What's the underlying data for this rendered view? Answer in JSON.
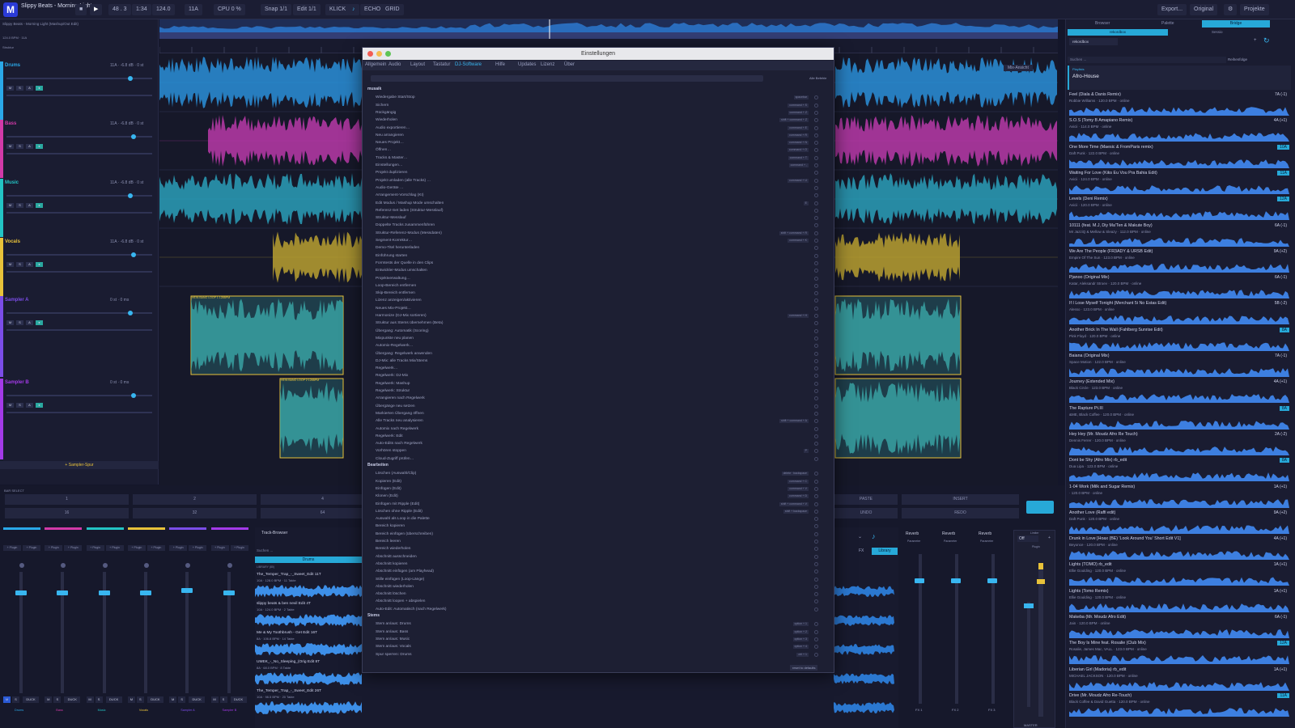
{
  "toolbar": {
    "logo": "M",
    "title": "Slippy Beats - Morning Light",
    "subtitle": "Slippy Beats - Morning Light (Mashup/Out Edit)",
    "bars": "48 . 3",
    "time": "1:34",
    "bpm": "124.0",
    "key": "11A",
    "cpu": "CPU 0 %",
    "snap": "Snap 1/1",
    "edit": "Edit 1/1",
    "klick": "KLICK",
    "echo": "ECHO",
    "grid": "GRID",
    "export": "Export...",
    "original": "Original",
    "projects": "Projekte"
  },
  "left": {
    "info1": "124.0 BPM · 11A",
    "info2": "Struktur",
    "tracks": [
      {
        "name": "Drums",
        "color": "#2aa8e8",
        "info": "11A · -6.8 dB · 0 st"
      },
      {
        "name": "Bass",
        "color": "#d23aa8",
        "info": "11A · -6.8 dB · 0 st"
      },
      {
        "name": "Music",
        "color": "#23c4c4",
        "info": "11A · -6.8 dB · 0 st"
      },
      {
        "name": "Vocals",
        "color": "#e8c23a",
        "info": "11A · -6.8 dB · 0 st"
      },
      {
        "name": "Sampler A",
        "color": "#7b4de8",
        "info": "0 st · 0 ms"
      },
      {
        "name": "Sampler B",
        "color": "#a33ae8",
        "info": "0 st · 0 ms"
      }
    ],
    "add_sampler": "+ Sampler-Spur"
  },
  "arrange": {
    "mix_view": "Mix-Ansicht",
    "clip_a": "HEIN BANG LOOP 1 128BPM",
    "clip_b": "HEIN BANG LOOP 2 128BPM"
  },
  "dialog": {
    "title": "Einstellungen",
    "tabs": [
      "Allgemein",
      "Audio",
      "Layout",
      "Tastatur",
      "DJ-Software",
      "Hilfe",
      "Updates",
      "Lizenz",
      "Über"
    ],
    "all_label": "Alle Befehle",
    "reset": "reset to defaults",
    "sections": [
      {
        "name": "musaik",
        "rows": [
          {
            "label": "Wiedergabe Start/Stop",
            "shortcut": "spacebar"
          },
          {
            "label": "Sichern",
            "shortcut": "command + S"
          },
          {
            "label": "Rückgängig",
            "shortcut": "command + Z"
          },
          {
            "label": "Wiederholen",
            "shortcut": "shift + command + Z"
          },
          {
            "label": "Audio exportieren…",
            "shortcut": "command + E"
          },
          {
            "label": "Neu arrangieren",
            "shortcut": "command + R"
          },
          {
            "label": "Neues Projekt…",
            "shortcut": "command + N"
          },
          {
            "label": "Öffnen…",
            "shortcut": "command + O"
          },
          {
            "label": "Tracks & Master…",
            "shortcut": "command + T"
          },
          {
            "label": "Einstellungen…",
            "shortcut": "command + ,"
          },
          {
            "label": "Projekt duplizieren",
            "shortcut": ""
          },
          {
            "label": "Projekt umladen (alle Tracks) …",
            "shortcut": "command + U"
          },
          {
            "label": "Audio-Geräte …",
            "shortcut": ""
          },
          {
            "label": "Arrangement-Vorschlag (KI)",
            "shortcut": ""
          },
          {
            "label": "Edit Modus / Mashup Mode umschalten",
            "shortcut": "E"
          },
          {
            "label": "Referenz-Set laden (Struktur-Messlauf)",
            "shortcut": ""
          },
          {
            "label": "Struktur-Messlauf",
            "shortcut": ""
          },
          {
            "label": "Doppelte Tracks zusammenführen",
            "shortcut": ""
          },
          {
            "label": "Struktur-Referenz-Modus (Messdaten)",
            "shortcut": "shift + command + R"
          },
          {
            "label": "Segment-Korrektur…",
            "shortcut": "command + K"
          },
          {
            "label": "Demo-Titel herunterladen",
            "shortcut": ""
          },
          {
            "label": "Einführung starten",
            "shortcut": ""
          },
          {
            "label": "Formtests der Quelle in den Clips",
            "shortcut": ""
          },
          {
            "label": "Entwickler-Modus umschalten",
            "shortcut": ""
          },
          {
            "label": "Projektverwaltung…",
            "shortcut": ""
          },
          {
            "label": "Loop-Bereich entfernen",
            "shortcut": ""
          },
          {
            "label": "Skip-Bereich entfernen",
            "shortcut": ""
          },
          {
            "label": "Lizenz anzeigen/aktivieren",
            "shortcut": ""
          },
          {
            "label": "Neues Mix-Projekt…",
            "shortcut": ""
          },
          {
            "label": "Harmonize (DJ-Mix sortieren)",
            "shortcut": "command + H"
          },
          {
            "label": "Struktur aus Stems übernehmen (Beta)",
            "shortcut": ""
          },
          {
            "label": "Übergang: Automatik (Scoring)",
            "shortcut": ""
          },
          {
            "label": "Mixpunkte neu planen",
            "shortcut": ""
          },
          {
            "label": "Automix-Regelwerk…",
            "shortcut": ""
          },
          {
            "label": "Übergang: Regelwerk anwenden",
            "shortcut": ""
          },
          {
            "label": "DJ-Mix: alle Tracks Mix/Stems",
            "shortcut": ""
          },
          {
            "label": "Regelwerk…",
            "shortcut": ""
          },
          {
            "label": "Regelwerk: DJ-Mix",
            "shortcut": ""
          },
          {
            "label": "Regelwerk: Mashup",
            "shortcut": ""
          },
          {
            "label": "Regelwerk: Struktur",
            "shortcut": ""
          },
          {
            "label": "Arrangieren nach Regelwerk",
            "shortcut": ""
          },
          {
            "label": "Übergänge neu setzen",
            "shortcut": ""
          },
          {
            "label": "Markierten Übergang öffnen",
            "shortcut": ""
          },
          {
            "label": "Alle Tracks neu analysieren",
            "shortcut": "shift + command + A"
          },
          {
            "label": "Automix nach Regelwerk",
            "shortcut": ""
          },
          {
            "label": "Regelwerk: Edit",
            "shortcut": ""
          },
          {
            "label": "Auto-Edits nach Regelwerk",
            "shortcut": ""
          },
          {
            "label": "Vorhören stoppen",
            "shortcut": "P"
          },
          {
            "label": "Cloud-Zugriff prüfen…",
            "shortcut": ""
          }
        ]
      },
      {
        "name": "Bearbeiten",
        "rows": [
          {
            "label": "Löschen (Auswahl/Clip)",
            "shortcut": "delete · backspace"
          },
          {
            "label": "Kopieren (Edit)",
            "shortcut": "command + C"
          },
          {
            "label": "Einfügen (Edit)",
            "shortcut": "command + V"
          },
          {
            "label": "Klonen (Edit)",
            "shortcut": "command + D"
          },
          {
            "label": "Einfügen mit Ripple (Edit)",
            "shortcut": "shift + command + V"
          },
          {
            "label": "Löschen ohne Ripple (Edit)",
            "shortcut": "shift + backspace"
          },
          {
            "label": "Auswahl als Loop in die Palette",
            "shortcut": ""
          },
          {
            "label": "Bereich kopieren",
            "shortcut": ""
          },
          {
            "label": "Bereich einfügen (überschreiben)",
            "shortcut": ""
          },
          {
            "label": "Bereich leeren",
            "shortcut": ""
          },
          {
            "label": "Bereich wiederholen",
            "shortcut": ""
          },
          {
            "label": "Abschnitt ausschneiden",
            "shortcut": ""
          },
          {
            "label": "Abschnitt kopieren",
            "shortcut": ""
          },
          {
            "label": "Abschnitt einfügen (am Playhead)",
            "shortcut": ""
          },
          {
            "label": "Stille einfügen (Loop-Länge)",
            "shortcut": ""
          },
          {
            "label": "Abschnitt wiederholen",
            "shortcut": ""
          },
          {
            "label": "Abschnitt löschen",
            "shortcut": ""
          },
          {
            "label": "Abschnitt loopen + abspielen",
            "shortcut": ""
          },
          {
            "label": "Auto-Edit: Automatisch (nach Regelwerk)",
            "shortcut": ""
          }
        ]
      },
      {
        "name": "Stems",
        "rows": [
          {
            "label": "Stem an/aus: Drums",
            "shortcut": "option + 1"
          },
          {
            "label": "Stem an/aus: Bass",
            "shortcut": "option + 2"
          },
          {
            "label": "Stem an/aus: Music",
            "shortcut": "option + 3"
          },
          {
            "label": "Stem an/aus: Vocals",
            "shortcut": "option + 4"
          },
          {
            "label": "Spur sperren: Drums",
            "shortcut": "ctrl + 1"
          }
        ]
      }
    ]
  },
  "right": {
    "tabs": [
      "Browser",
      "Palette",
      "Bridge"
    ],
    "subtabs": [
      "rekordbox",
      "Sessio"
    ],
    "source": "rekordbox",
    "search_placeholder": "Suchen ...",
    "sort": "Reihenfolge",
    "playlist_label": "Playlists",
    "playlist": "Afro-House",
    "songs": [
      {
        "title": "Feel (Diala & Danis Remix)",
        "sub": "Robbie Williams · 120.0 BPM · online",
        "key": "7A (-1)",
        "hl": false
      },
      {
        "title": "S.O.S (Tomy B Amapiano Remix)",
        "sub": "Avicii · 114.0 BPM · online",
        "key": "4A (+1)",
        "hl": false
      },
      {
        "title": "One More Time (Maesic & FromParis remix)",
        "sub": "Daft Punk · 122.0 BPM · online",
        "key": "10A",
        "hl": true
      },
      {
        "title": "Waiting For Love (Kiks Eu Vou Pra Bahia Edit)",
        "sub": "Avicii · 124.0 BPM · online",
        "key": "11A",
        "hl": true
      },
      {
        "title": "Levels (Deni Remix)",
        "sub": "Avicii · 120.0 BPM · online",
        "key": "12A",
        "hl": true
      },
      {
        "title": "10111 (feat. M.J, Diy Ma'Ten & Makute Boy)",
        "sub": "Mr JazziQ & Mellow & Sleazy · 112.0 BPM · online",
        "key": "6A (-1)",
        "hl": false
      },
      {
        "title": "We Are The People (FR3ADY & URSB Edit)",
        "sub": "Empire Of The Sun · 123.0 BPM · online",
        "key": "9A (+2)",
        "hl": false
      },
      {
        "title": "Pjanoo (Original Mix)",
        "sub": "Katar, Aleksandr Stroev · 120.0 BPM · online",
        "key": "6A (-1)",
        "hl": false
      },
      {
        "title": "If I Lose Myself Tonight (Merchant 5i No Estas Edit)",
        "sub": "Alesso · 123.0 BPM · online",
        "key": "5B (-2)",
        "hl": false
      },
      {
        "title": "Another Brick In The Wall (Fahlberg Sunrise Edit)",
        "sub": "Pink Floyd · 120.0 BPM · online",
        "key": "8A",
        "hl": true
      },
      {
        "title": "Baiana (Original Mix)",
        "sub": "Space Motion · 122.0 BPM · online",
        "key": "7A (-1)",
        "hl": false
      },
      {
        "title": "Journey (Extended Mix)",
        "sub": "Black Circle · 123.0 BPM · online",
        "key": "4A (+1)",
        "hl": false
      },
      {
        "title": "The Rapture Pt.III",
        "sub": "&ME, Black Coffee · 120.0 BPM · online",
        "key": "8A",
        "hl": true
      },
      {
        "title": "Hey Hey (Mr. Moudz Afro Re Touch)",
        "sub": "Dennis Ferrer · 120.0 BPM · online",
        "key": "2A (-2)",
        "hl": false
      },
      {
        "title": "Dont be Shy (Afro Mix) rb_edit",
        "sub": "Dua Lipa · 123.0 BPM · online",
        "key": "8A",
        "hl": true
      },
      {
        "title": "1-04 Work (Milk and Sugar Remix)",
        "sub": "· 120.0 BPM · online",
        "key": "1A (+1)",
        "hl": false
      },
      {
        "title": "Another Love (Raffi edit)",
        "sub": "Daft Punk · 120.0 BPM · online",
        "key": "9A (+2)",
        "hl": false
      },
      {
        "title": "Drunk in Love [Hoax (BE) 'Look Around You' Short Edit V1]",
        "sub": "Beyonce · 120.0 BPM · online",
        "key": "4A (+1)",
        "hl": false
      },
      {
        "title": "Lights (TOMO) rb_edit",
        "sub": "Ellie Goulding · 120.0 BPM · online",
        "key": "1A (+1)",
        "hl": false
      },
      {
        "title": "Lights (Tomo Remix)",
        "sub": "Ellie Goulding · 120.0 BPM · online",
        "key": "1A (+1)",
        "hl": false
      },
      {
        "title": "Makeba (Mr. Moudz Afro Edit)",
        "sub": "Jain · 120.0 BPM · online",
        "key": "6A (-1)",
        "hl": false
      },
      {
        "title": "The Boy Is Mine feat. Rosalie (Club Mix)",
        "sub": "Rosalie, James Mac, VALL · 123.0 BPM · online",
        "key": "12A",
        "hl": true
      },
      {
        "title": "Liberian Girl (Madoria) rb_edit",
        "sub": "MICHAEL JACKSON · 120.0 BPM · online",
        "key": "1A (+1)",
        "hl": false
      },
      {
        "title": "Drive (Mr. Moudz Afro Re-Touch)",
        "sub": "Black Coffee & David Guetta · 120.0 BPM · online",
        "key": "11A",
        "hl": true
      }
    ]
  },
  "bottom": {
    "bar_select": "BAR SELECT",
    "pads_top": [
      "1",
      "2",
      "4"
    ],
    "pads_bottom": [
      "16",
      "32",
      "64"
    ],
    "undo": "UNDO",
    "redo": "REDO",
    "paste": "PASTE",
    "insert": "INSERT",
    "track_browser": "Track-Browser",
    "search_placeholder": "Suchen ...",
    "drums_tab": "Drums",
    "library_header": "LIBRARY (80)",
    "fx_label": "FX",
    "library_btn": "Library",
    "clips": [
      {
        "title": "The_Temper_Trap_-_Sweet_Edit 11T",
        "sub": "10A · 128.0 BPM · 11 Takte"
      },
      {
        "title": "slippy beats & ben nevil Edit 4T",
        "sub": "10A · 124.0 BPM · 2 Takte"
      },
      {
        "title": "Me & My Toothbrush - Get Edit 16T",
        "sub": "8A · 106.8 BPM · 14 Takte"
      },
      {
        "title": "UMEK_-_No_Sleeping_(Orig Edit 8T",
        "sub": "8A · 68.0 BPM · 8 Takte"
      },
      {
        "title": "The_Temper_Trap_-_Sweet_Edit 26T",
        "sub": "10A · 98.5 BPM · 20 Takte"
      }
    ],
    "channels": [
      {
        "name": "Drums",
        "color": "#2aa8e8"
      },
      {
        "name": "Bass",
        "color": "#d23aa8"
      },
      {
        "name": "Music",
        "color": "#23c4c4"
      },
      {
        "name": "Vocals",
        "color": "#e8c23a"
      },
      {
        "name": "Sampler A",
        "color": "#7b4de8"
      },
      {
        "name": "Sampler B",
        "color": "#a33ae8"
      }
    ],
    "plugin_label": "+ Plugin",
    "duck": "DUCK",
    "fx_units": [
      {
        "name": "Reverb",
        "param": "Parameter",
        "label": "FX 1"
      },
      {
        "name": "Reverb",
        "param": "Parameter",
        "label": "FX 2"
      },
      {
        "name": "Reverb",
        "param": "Parameter",
        "label": "FX 3"
      }
    ],
    "limiter": "Limiter",
    "off": "Off",
    "plugin": "Plugin",
    "master": "MASTER"
  }
}
